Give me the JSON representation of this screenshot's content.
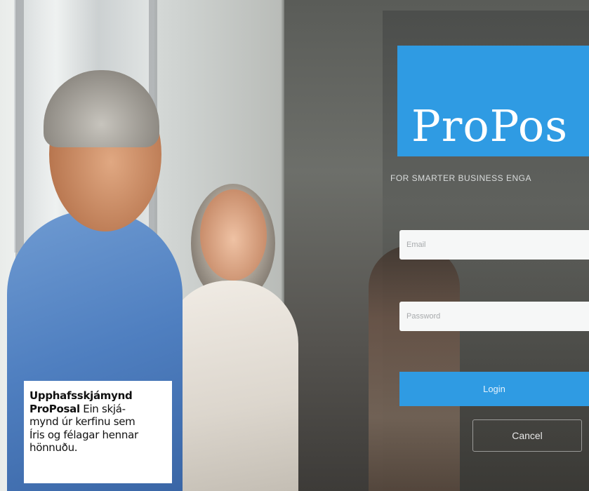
{
  "background": {
    "description_colors": {
      "ui_accent": "#2f9be3",
      "field_bg": "#f6f7f7"
    }
  },
  "app": {
    "logo_text": "ProPos",
    "tagline": "FOR SMARTER BUSINESS ENGA",
    "email_placeholder": "Email",
    "password_placeholder": "Password",
    "login_label": "Login",
    "cancel_label": "Cancel"
  },
  "caption": {
    "title_line1": "Upphafsskjámynd",
    "title_line2": "ProPosal",
    "body_line1": " Ein skjá-",
    "body_line2": "mynd úr kerfinu sem",
    "body_line3": "Íris og félagar hennar",
    "body_line4": "hönnuðu."
  }
}
